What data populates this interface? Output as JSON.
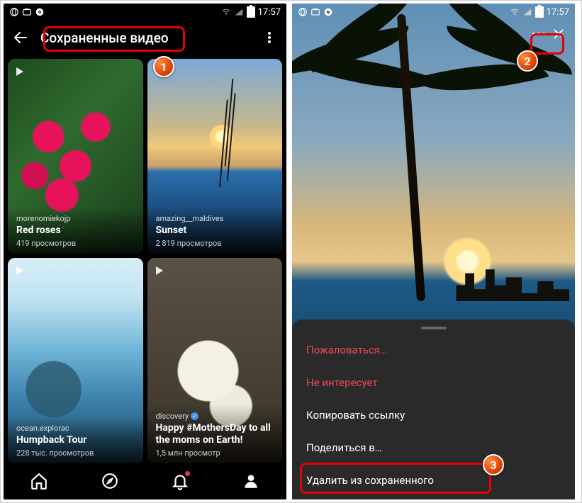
{
  "status": {
    "time": "17:57"
  },
  "phone1": {
    "title": "Сохраненные видео",
    "cards": [
      {
        "author": "morenomiekojp",
        "title": "Red roses",
        "views": "419 просмотров"
      },
      {
        "author": "amazing__maldives",
        "title": "Sunset",
        "views": "2 819 просмотров"
      },
      {
        "author": "ocean.explorac",
        "title": "Humpback Tour",
        "views": "228 тыс. просмотров"
      },
      {
        "author": "discovery",
        "title": "Happy #MothersDay to all the moms on Earth!",
        "views": "1,5 млн просмотр"
      }
    ]
  },
  "phone2": {
    "menu": {
      "report": "Пожаловаться…",
      "notint": "Не интересует",
      "copylink": "Копировать ссылку",
      "share": "Поделиться в…",
      "remove": "Удалить из сохраненного"
    }
  },
  "annotations": {
    "b1": "1",
    "b2": "2",
    "b3": "3"
  }
}
